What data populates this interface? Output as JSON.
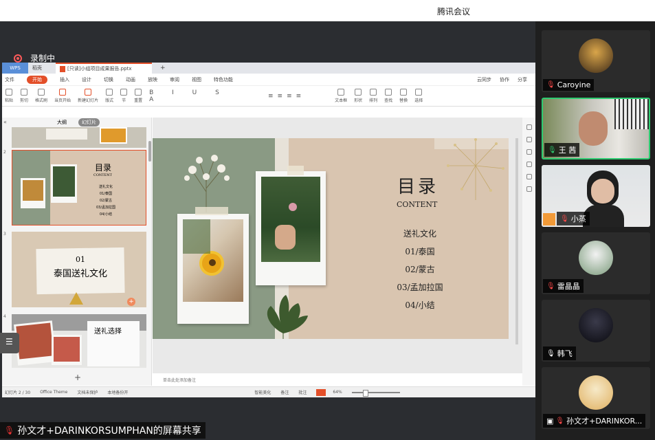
{
  "window": {
    "title": "腾讯会议"
  },
  "recording": {
    "label": "录制中"
  },
  "wps": {
    "tabs": {
      "logo": "WPS",
      "home": "稻壳",
      "doc": "[只读]小组项目成果报告.pptx"
    },
    "menu": [
      "文件",
      "开始",
      "插入",
      "设计",
      "切换",
      "动画",
      "放映",
      "审阅",
      "视图",
      "特色功能"
    ],
    "menu_start": "开始",
    "menu_right": [
      "云同步",
      "协作",
      "分享"
    ],
    "toolbar": [
      "粘贴",
      "剪切",
      "格式刷",
      "当页开始",
      "新建幻灯片",
      "版式",
      "节",
      "重置",
      "文本框",
      "形状",
      "排列",
      "查找",
      "替换",
      "选择"
    ],
    "panel_tabs": {
      "outline": "大纲",
      "slides": "幻灯片"
    },
    "thumbs": [
      {
        "num": "2",
        "title": "目录",
        "subtitle": "CONTENT",
        "items": [
          "送礼文化",
          "01/泰国",
          "02/蒙古",
          "03/孟加拉国",
          "04/小结"
        ]
      },
      {
        "num": "3",
        "title1": "01",
        "title2": "泰国送礼文化"
      },
      {
        "num": "4",
        "title": "送礼选择"
      }
    ],
    "slide": {
      "title": "目录",
      "subtitle": "CONTENT",
      "toc": [
        "送礼文化",
        "01/泰国",
        "02/蒙古",
        "03/孟加拉国",
        "04/小结"
      ]
    },
    "notes_placeholder": "单击此处添加备注",
    "status": {
      "slide_count": "幻灯片 2 / 30",
      "theme": "Office Theme",
      "doc_protect": "文档未保护",
      "backup": "本地备份开",
      "beautify": "智能美化",
      "notes": "备注",
      "comment": "批注",
      "zoom": "64%"
    }
  },
  "sharer_label": "孙文才+DARINKORSUMPHAN的屏幕共享",
  "participants": [
    {
      "name": "Caroyine",
      "mic": "muted"
    },
    {
      "name": "王 茜",
      "mic": "live"
    },
    {
      "name": "小蒸",
      "mic": "muted"
    },
    {
      "name": "雷晶晶",
      "mic": "muted"
    },
    {
      "name": "韩飞",
      "mic": "muted"
    },
    {
      "name": "孙文才+DARINKOR...",
      "mic": "muted"
    }
  ],
  "colors": {
    "accent": "#e34f29",
    "speaking": "#2ecc71",
    "slide_bg": "#d9c5b0",
    "slide_green": "#8a9a84"
  }
}
